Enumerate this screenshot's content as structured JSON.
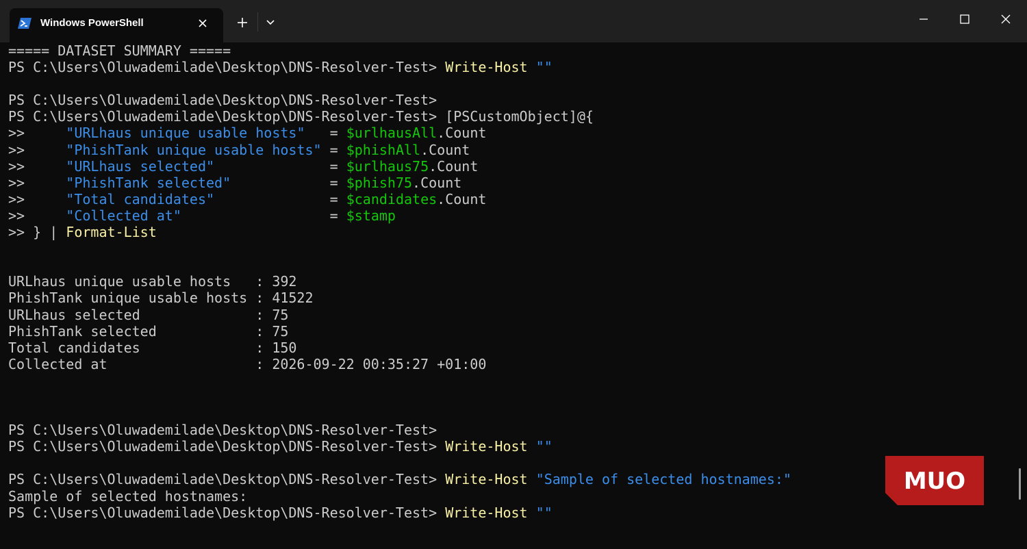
{
  "window": {
    "tab_title": "Windows PowerShell",
    "icons": {
      "tab": "powershell-icon",
      "close_tab": "close-icon",
      "new_tab": "plus-icon",
      "dropdown": "chevron-down-icon",
      "minimize": "minimize-icon",
      "maximize": "maximize-icon",
      "close_window": "close-icon"
    }
  },
  "colors": {
    "background": "#0c0c0c",
    "titlebar": "#202020",
    "text": "#cccccc",
    "command": "#f9f1a5",
    "string": "#3b8eea",
    "variable": "#16c60c",
    "watermark": "#b71c1c"
  },
  "terminal": {
    "lines": [
      [
        {
          "t": "===== DATASET SUMMARY =====",
          "c": "w"
        }
      ],
      [
        {
          "t": "PS C:\\Users\\Oluwademilade\\Desktop\\DNS-Resolver-Test> ",
          "c": "w"
        },
        {
          "t": "Write-Host",
          "c": "y"
        },
        {
          "t": " \"\"",
          "c": "b"
        }
      ],
      [],
      [
        {
          "t": "PS C:\\Users\\Oluwademilade\\Desktop\\DNS-Resolver-Test>",
          "c": "w"
        }
      ],
      [
        {
          "t": "PS C:\\Users\\Oluwademilade\\Desktop\\DNS-Resolver-Test> ",
          "c": "w"
        },
        {
          "t": "[PSCustomObject]@{",
          "c": "w"
        }
      ],
      [
        {
          "t": ">>     ",
          "c": "w"
        },
        {
          "t": "\"URLhaus unique usable hosts\"",
          "c": "b"
        },
        {
          "t": "   = ",
          "c": "w"
        },
        {
          "t": "$urlhausAll",
          "c": "g"
        },
        {
          "t": ".Count",
          "c": "w"
        }
      ],
      [
        {
          "t": ">>     ",
          "c": "w"
        },
        {
          "t": "\"PhishTank unique usable hosts\"",
          "c": "b"
        },
        {
          "t": " = ",
          "c": "w"
        },
        {
          "t": "$phishAll",
          "c": "g"
        },
        {
          "t": ".Count",
          "c": "w"
        }
      ],
      [
        {
          "t": ">>     ",
          "c": "w"
        },
        {
          "t": "\"URLhaus selected\"",
          "c": "b"
        },
        {
          "t": "              = ",
          "c": "w"
        },
        {
          "t": "$urlhaus75",
          "c": "g"
        },
        {
          "t": ".Count",
          "c": "w"
        }
      ],
      [
        {
          "t": ">>     ",
          "c": "w"
        },
        {
          "t": "\"PhishTank selected\"",
          "c": "b"
        },
        {
          "t": "            = ",
          "c": "w"
        },
        {
          "t": "$phish75",
          "c": "g"
        },
        {
          "t": ".Count",
          "c": "w"
        }
      ],
      [
        {
          "t": ">>     ",
          "c": "w"
        },
        {
          "t": "\"Total candidates\"",
          "c": "b"
        },
        {
          "t": "              = ",
          "c": "w"
        },
        {
          "t": "$candidates",
          "c": "g"
        },
        {
          "t": ".Count",
          "c": "w"
        }
      ],
      [
        {
          "t": ">>     ",
          "c": "w"
        },
        {
          "t": "\"Collected at\"",
          "c": "b"
        },
        {
          "t": "                  = ",
          "c": "w"
        },
        {
          "t": "$stamp",
          "c": "g"
        }
      ],
      [
        {
          "t": ">> } | ",
          "c": "w"
        },
        {
          "t": "Format-List",
          "c": "y"
        }
      ],
      [],
      [],
      [
        {
          "t": "URLhaus unique usable hosts   : 392",
          "c": "w"
        }
      ],
      [
        {
          "t": "PhishTank unique usable hosts : 41522",
          "c": "w"
        }
      ],
      [
        {
          "t": "URLhaus selected              : 75",
          "c": "w"
        }
      ],
      [
        {
          "t": "PhishTank selected            : 75",
          "c": "w"
        }
      ],
      [
        {
          "t": "Total candidates              : 150",
          "c": "w"
        }
      ],
      [
        {
          "t": "Collected at                  : 2026-09-22 00:35:27 +01:00",
          "c": "w"
        }
      ],
      [],
      [],
      [],
      [
        {
          "t": "PS C:\\Users\\Oluwademilade\\Desktop\\DNS-Resolver-Test>",
          "c": "w"
        }
      ],
      [
        {
          "t": "PS C:\\Users\\Oluwademilade\\Desktop\\DNS-Resolver-Test> ",
          "c": "w"
        },
        {
          "t": "Write-Host",
          "c": "y"
        },
        {
          "t": " \"\"",
          "c": "b"
        }
      ],
      [],
      [
        {
          "t": "PS C:\\Users\\Oluwademilade\\Desktop\\DNS-Resolver-Test> ",
          "c": "w"
        },
        {
          "t": "Write-Host",
          "c": "y"
        },
        {
          "t": " \"Sample of selected hostnames:\"",
          "c": "b"
        }
      ],
      [
        {
          "t": "Sample of selected hostnames:",
          "c": "w"
        }
      ],
      [
        {
          "t": "PS C:\\Users\\Oluwademilade\\Desktop\\DNS-Resolver-Test> ",
          "c": "w"
        },
        {
          "t": "Write-Host",
          "c": "y"
        },
        {
          "t": " \"\"",
          "c": "b"
        }
      ]
    ]
  },
  "watermark": {
    "text": "MUO"
  }
}
